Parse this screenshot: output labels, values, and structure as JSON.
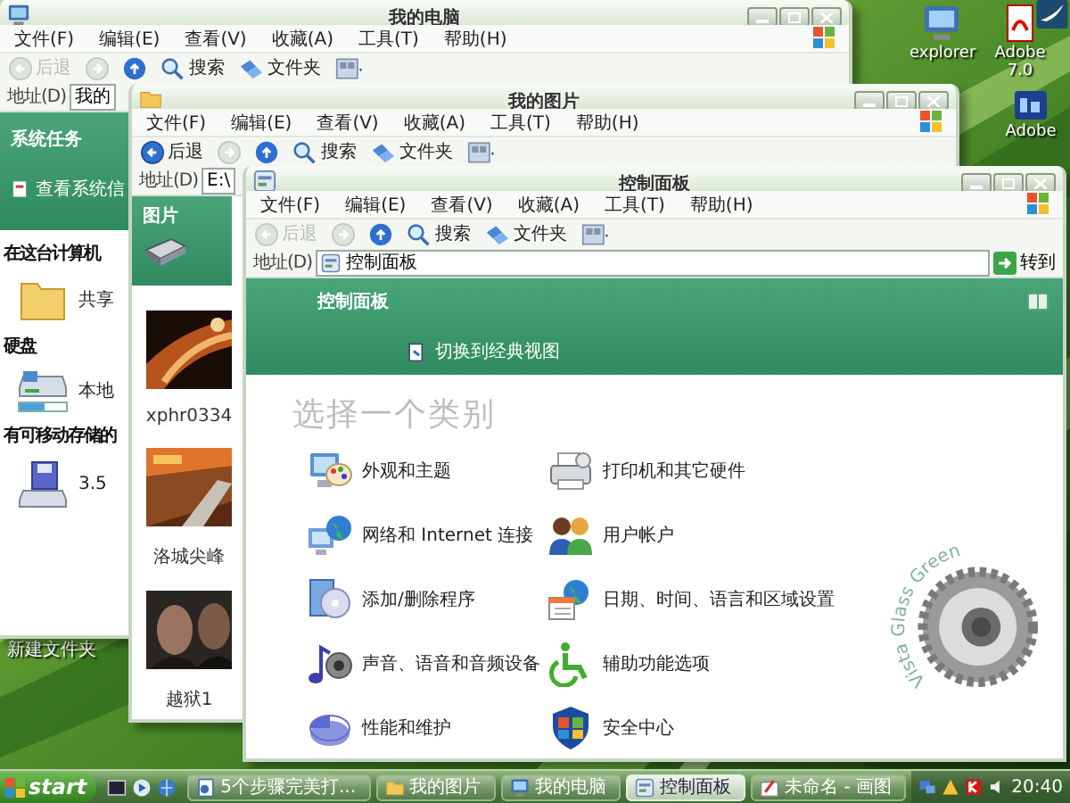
{
  "desktop": {
    "icons": [
      {
        "label": "explorer"
      },
      {
        "label": "Adobe 7.0"
      },
      {
        "label": "Adobe"
      }
    ],
    "folder_label": "新建文件夹"
  },
  "my_computer": {
    "title": "我的电脑",
    "menu": [
      "文件(F)",
      "编辑(E)",
      "查看(V)",
      "收藏(A)",
      "工具(T)",
      "帮助(H)"
    ],
    "back": {
      "label": "后退",
      "disabled": true
    },
    "toolbar": [
      "搜索",
      "文件夹"
    ],
    "address_label": "地址(D)",
    "address": "我的",
    "tasks": {
      "header": "系统任务",
      "items": [
        "查看系统信"
      ]
    },
    "sections": [
      {
        "heading": "在这台计算机",
        "items": [
          {
            "label": "共享",
            "kind": "folder"
          }
        ]
      },
      {
        "heading": "硬盘",
        "items": [
          {
            "label": "本地",
            "kind": "drive",
            "level": 0.55
          }
        ]
      },
      {
        "heading": "有可移动存储的",
        "items": [
          {
            "label": "3.5",
            "kind": "floppy"
          }
        ]
      }
    ]
  },
  "my_pictures": {
    "title": "我的图片",
    "menu": [
      "文件(F)",
      "编辑(E)",
      "查看(V)",
      "收藏(A)",
      "工具(T)",
      "帮助(H)"
    ],
    "back": {
      "label": "后退",
      "disabled": false
    },
    "toolbar": [
      "搜索",
      "文件夹"
    ],
    "address_label": "地址(D)",
    "address": "E:\\",
    "tasks_header": "图片",
    "photos": [
      {
        "caption": "xphr0334"
      },
      {
        "caption": "洛城尖峰"
      },
      {
        "caption": "越狱1"
      }
    ]
  },
  "control_panel": {
    "title": "控制面板",
    "menu": [
      "文件(F)",
      "编辑(E)",
      "查看(V)",
      "收藏(A)",
      "工具(T)",
      "帮助(H)"
    ],
    "back": {
      "label": "后退",
      "disabled": true
    },
    "toolbar": [
      "搜索",
      "文件夹"
    ],
    "address_label": "地址(D)",
    "address": "控制面板",
    "go": "转到",
    "header": "控制面板",
    "switch_link": "切换到经典视图",
    "heading": "选择一个类别",
    "categories": [
      "外观和主题",
      "打印机和其它硬件",
      "网络和 Internet 连接",
      "用户帐户",
      "添加/删除程序",
      "日期、时间、语言和区域设置",
      "声音、语音和音频设备",
      "辅助功能选项",
      "性能和维护",
      "安全中心"
    ],
    "emblem": "Vista Glass Green"
  },
  "taskbar": {
    "start": "start",
    "tasks": [
      {
        "label": "5个步骤完美打...",
        "selected": false
      },
      {
        "label": "我的图片",
        "selected": false
      },
      {
        "label": "我的电脑",
        "selected": false
      },
      {
        "label": "控制面板",
        "selected": true
      },
      {
        "label": "未命名 - 画图",
        "selected": false
      }
    ],
    "clock": "20:40"
  }
}
